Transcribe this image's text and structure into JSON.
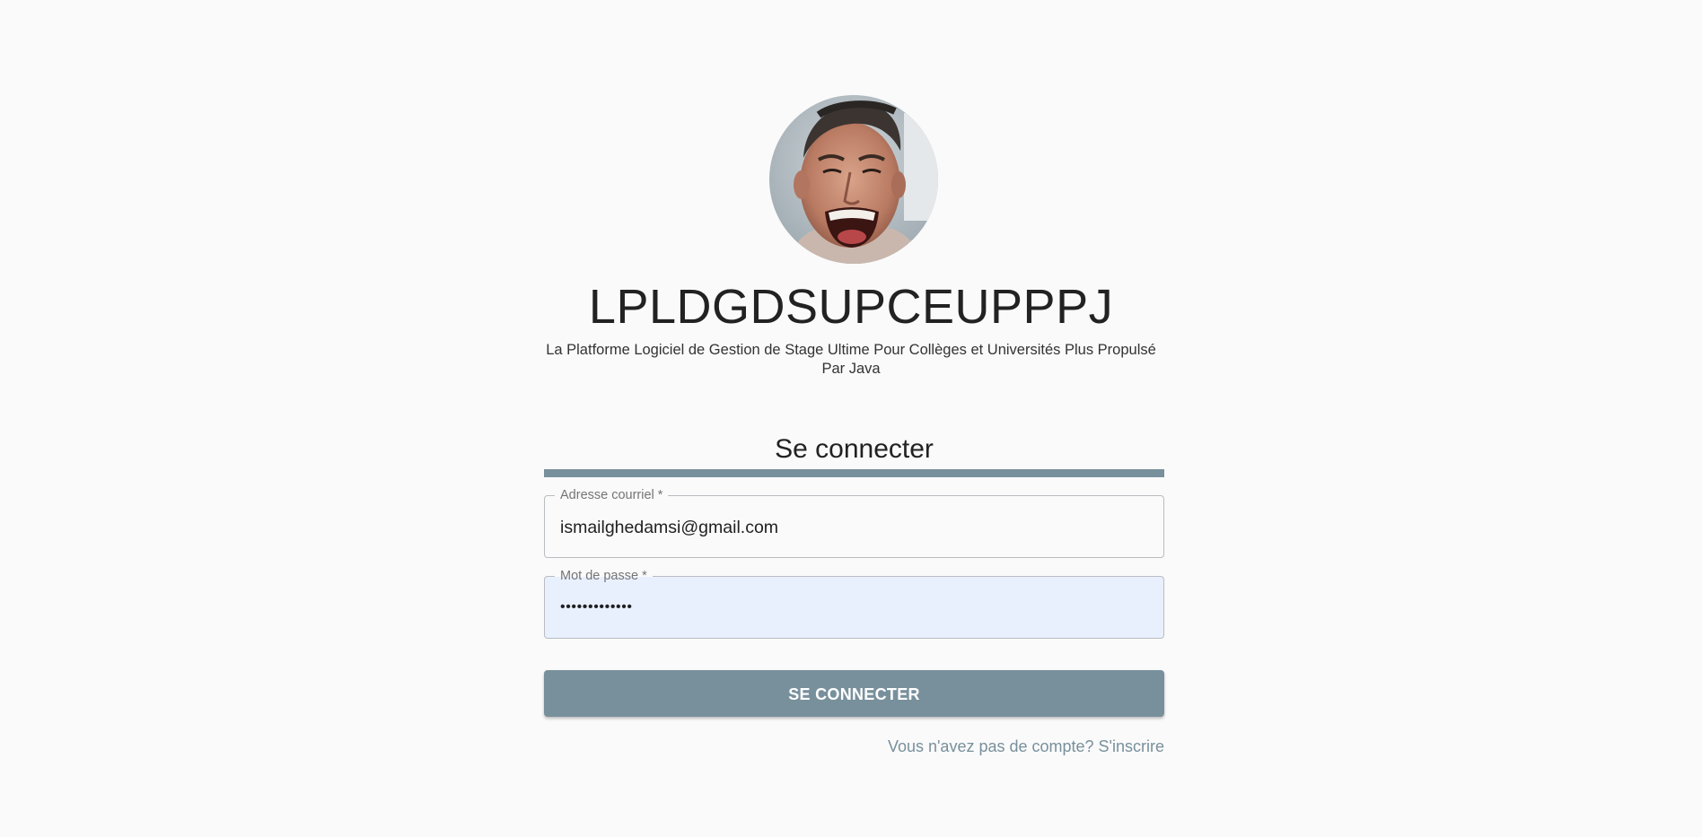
{
  "header": {
    "avatar_icon": "user-photo",
    "app_title": "LPLDGDSUPCEUPPPJ",
    "app_subtitle": "La Platforme Logiciel de Gestion de Stage Ultime Pour Collèges et Universités Plus Propulsé Par Java"
  },
  "login": {
    "title": "Se connecter",
    "email_label": "Adresse courriel *",
    "email_value": "ismailghedamsi@gmail.com",
    "password_label": "Mot de passe *",
    "password_value": "•••••••••••••",
    "submit_label": "SE CONNECTER",
    "signup_link": "Vous n'avez pas de compte? S'inscrire"
  },
  "colors": {
    "accent": "#78909c",
    "autofill_bg": "#e8f0fe",
    "page_bg": "#fafafa"
  }
}
